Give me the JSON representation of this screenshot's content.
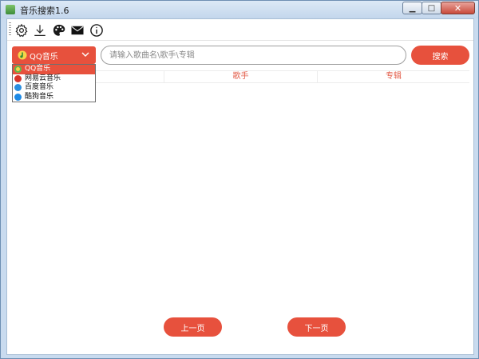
{
  "window": {
    "title": "音乐搜索1.6",
    "minimize_glyph": "▁",
    "maximize_glyph": "□",
    "close_glyph": "✕"
  },
  "toolbar": {
    "icons": [
      "gear-icon",
      "download-icon",
      "palette-icon",
      "mail-icon",
      "info-icon"
    ]
  },
  "source": {
    "selected": "QQ音乐",
    "options": [
      "QQ音乐",
      "网易云音乐",
      "百度音乐",
      "酷狗音乐"
    ]
  },
  "search": {
    "placeholder": "请输入歌曲名\\歌手\\专辑",
    "value": "",
    "button_label": "搜索"
  },
  "table": {
    "columns": [
      "",
      "歌手",
      "专辑"
    ]
  },
  "pagination": {
    "prev_label": "上一页",
    "next_label": "下一页"
  },
  "colors": {
    "accent": "#e7513d",
    "header_text": "#e25b47",
    "title_bar": "#c9dbef"
  }
}
